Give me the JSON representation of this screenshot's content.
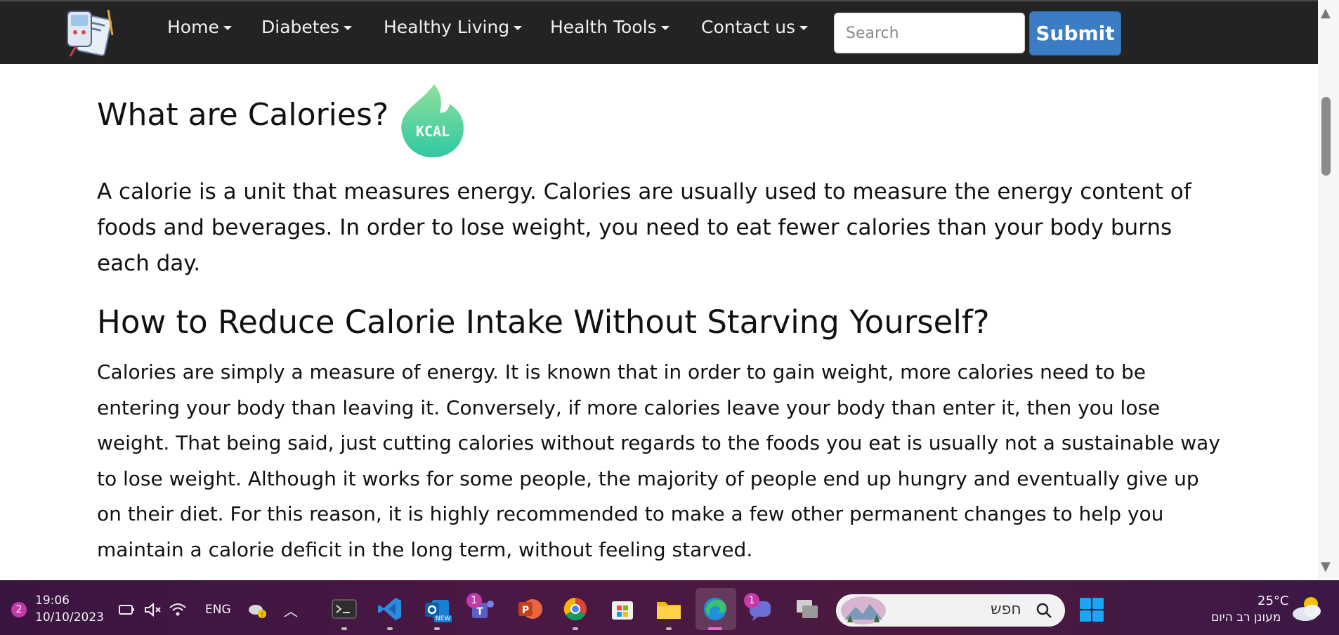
{
  "nav": {
    "items": [
      {
        "label": "Home"
      },
      {
        "label": "Diabetes"
      },
      {
        "label": "Healthy Living"
      },
      {
        "label": "Health Tools"
      },
      {
        "label": "Contact us"
      }
    ],
    "search_placeholder": "Search",
    "submit_label": "Submit"
  },
  "article": {
    "title": "What are Calories?",
    "badge_text": "KCAL",
    "intro": "A calorie is a unit that measures energy. Calories are usually used to measure the energy content of foods and beverages. In order to lose weight, you need to eat fewer calories than your body burns each day.",
    "section_title": "How to Reduce Calorie Intake Without Starving Yourself?",
    "section_body": "Calories are simply a measure of energy. It is known that in order to gain weight, more calories need to be entering your body than leaving it. Conversely, if more calories leave your body than enter it, then you lose weight. That being said, just cutting calories without regards to the foods you eat is usually not a sustainable way to lose weight. Although it works for some people, the majority of people end up hungry and eventually give up on their diet. For this reason, it is highly recommended to make a few other permanent changes to help you maintain a calorie deficit in the long term, without feeling starved."
  },
  "taskbar": {
    "notification_count": "2",
    "time": "19:06",
    "date": "10/10/2023",
    "language": "ENG",
    "teams_badge": "1",
    "chat_badge": "1",
    "search_text": "חפש",
    "new_badge": "NEW",
    "weather_temp": "25°C",
    "weather_desc": "מעונן רב היום",
    "icons": [
      "terminal-icon",
      "vscode-icon",
      "outlook-icon",
      "teams-icon",
      "powerpoint-icon",
      "chrome-icon",
      "store-icon",
      "folder-icon",
      "edge-icon",
      "chat-icon",
      "task-view-icon"
    ]
  },
  "colors": {
    "navbar_bg": "#232323",
    "submit_bg": "#3a7dc4",
    "taskbar_bg": "#4b1844",
    "kcal_green_top": "#8fe09b",
    "kcal_green_bottom": "#2fc8a2"
  }
}
